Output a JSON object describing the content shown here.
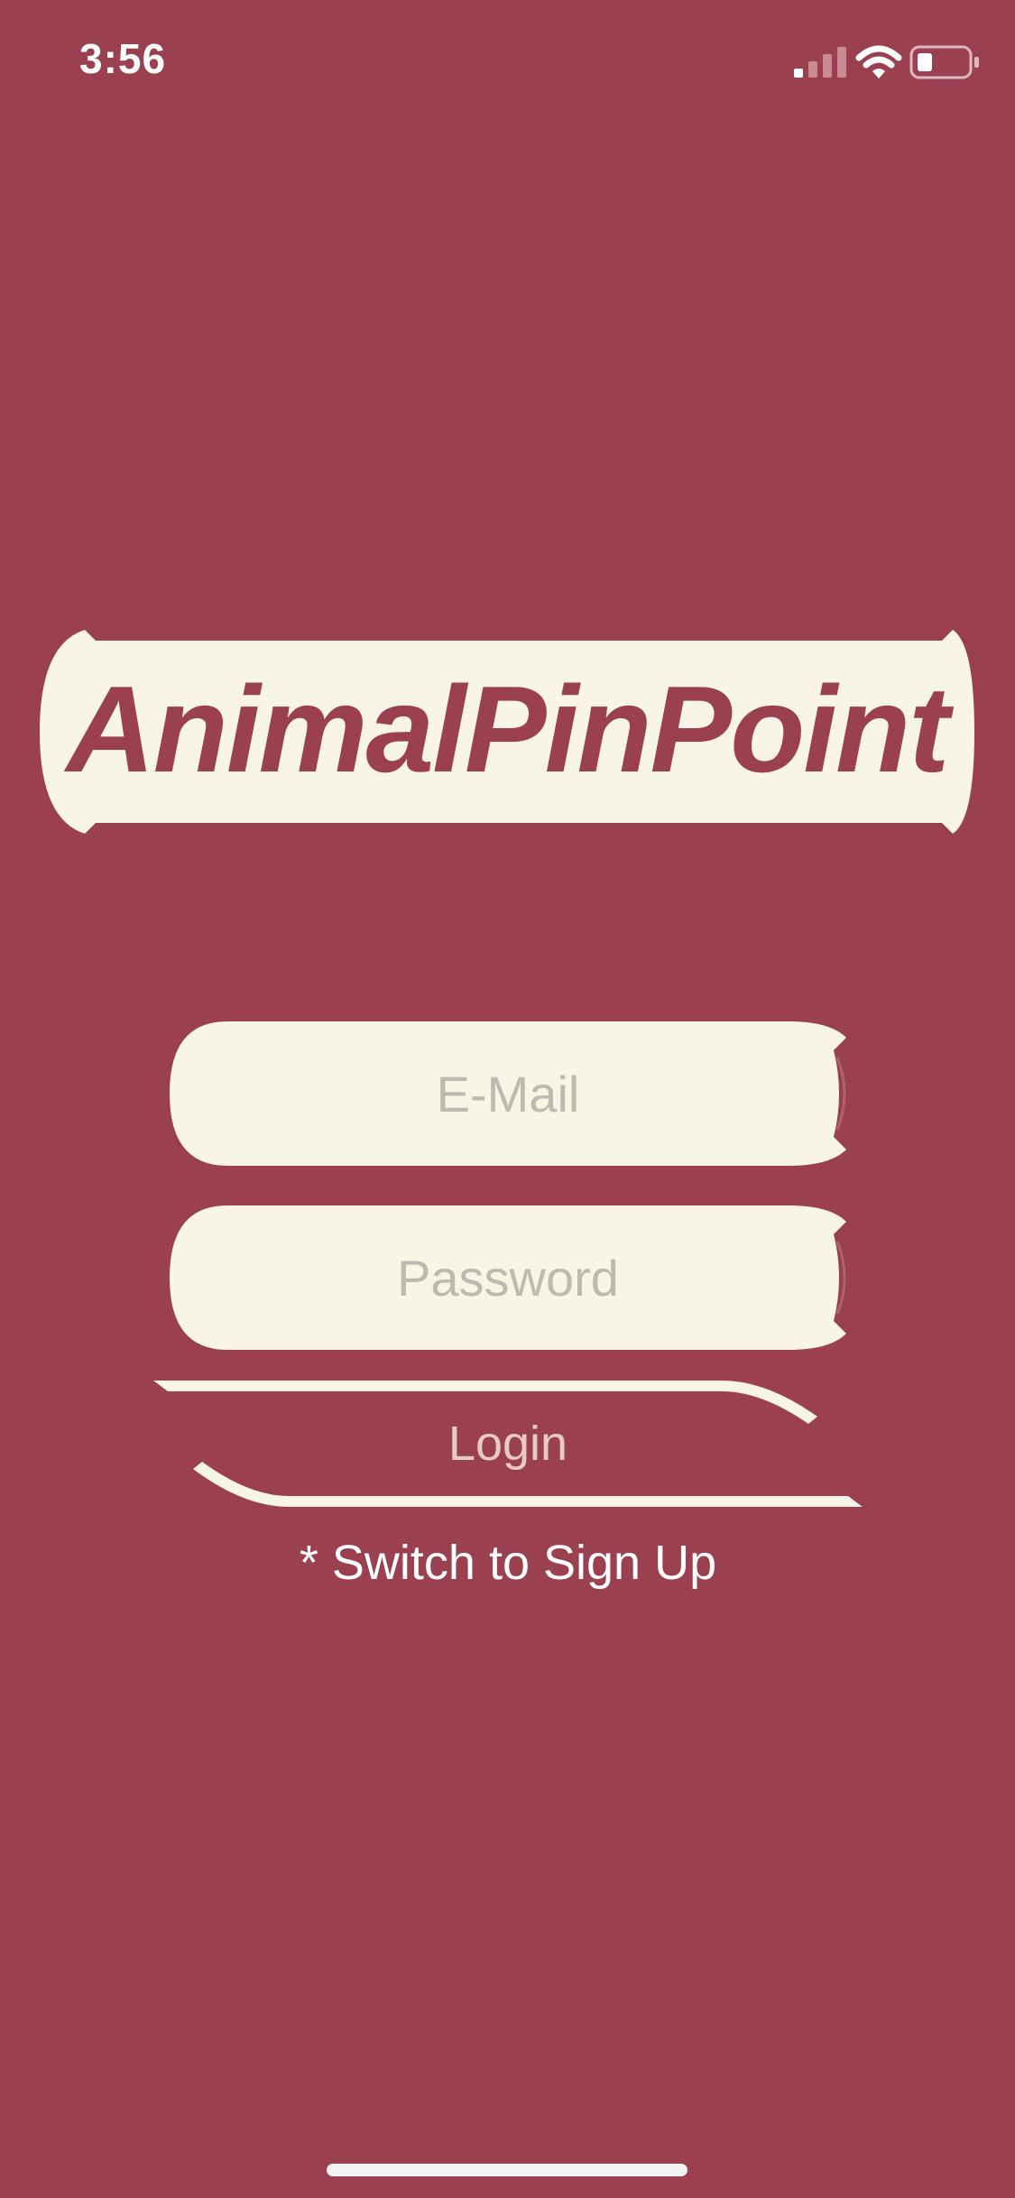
{
  "status_bar": {
    "time": "3:56"
  },
  "app": {
    "title": "AnimalPinPoint"
  },
  "form": {
    "email_placeholder": "E-Mail",
    "password_placeholder": "Password",
    "login_label": "Login",
    "switch_label": "* Switch to Sign Up"
  },
  "icons": {
    "signal": "signal-strength-icon",
    "wifi": "wifi-icon",
    "battery": "battery-icon"
  },
  "colors": {
    "background": "#9A4050",
    "cream": "#F8F4E6",
    "placeholder": "#BEBAB1",
    "login_text": "#E7C9C5",
    "white": "#FFFFFF"
  }
}
